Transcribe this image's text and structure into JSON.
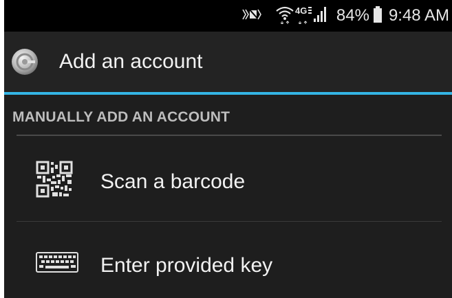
{
  "status_bar": {
    "icons": [
      "mute-icon",
      "wifi-icon",
      "4g-lte-icon",
      "cell-signal-icon",
      "battery-icon"
    ],
    "battery_percent": "84%",
    "time": "9:48 AM"
  },
  "action_bar": {
    "app_icon": "authenticator-logo-icon",
    "title": "Add an account"
  },
  "section": {
    "header": "MANUALLY ADD AN ACCOUNT"
  },
  "options": [
    {
      "icon": "qr-code-icon",
      "label": "Scan a barcode"
    },
    {
      "icon": "keyboard-icon",
      "label": "Enter provided key"
    }
  ],
  "colors": {
    "background": "#1e1e1e",
    "status_bar": "#000000",
    "accent_divider": "#34b5e5",
    "text_primary": "#f2f2f2",
    "text_section": "#bdbdbd"
  }
}
